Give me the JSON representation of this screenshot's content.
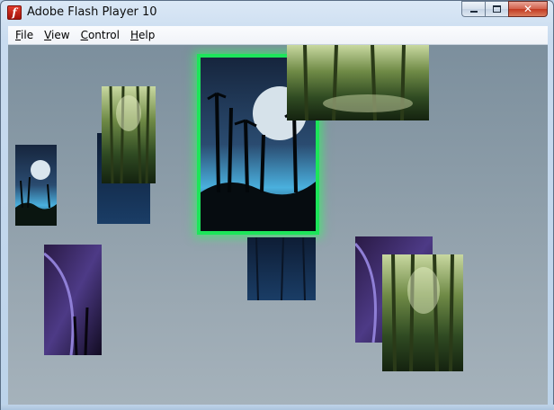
{
  "window": {
    "title": "Adobe Flash Player 10",
    "app_icon_glyph": "f",
    "buttons": {
      "close_glyph": "✕"
    }
  },
  "menu": [
    {
      "label_u": "F",
      "label_rest": "ile"
    },
    {
      "label_u": "V",
      "label_rest": "iew"
    },
    {
      "label_u": "C",
      "label_rest": "ontrol"
    },
    {
      "label_u": "H",
      "label_rest": "elp"
    }
  ],
  "gallery": {
    "selection_color": "#1de55a",
    "icons": [
      "adobe-flash-icon",
      "minimize-icon",
      "maximize-icon",
      "close-icon"
    ]
  }
}
